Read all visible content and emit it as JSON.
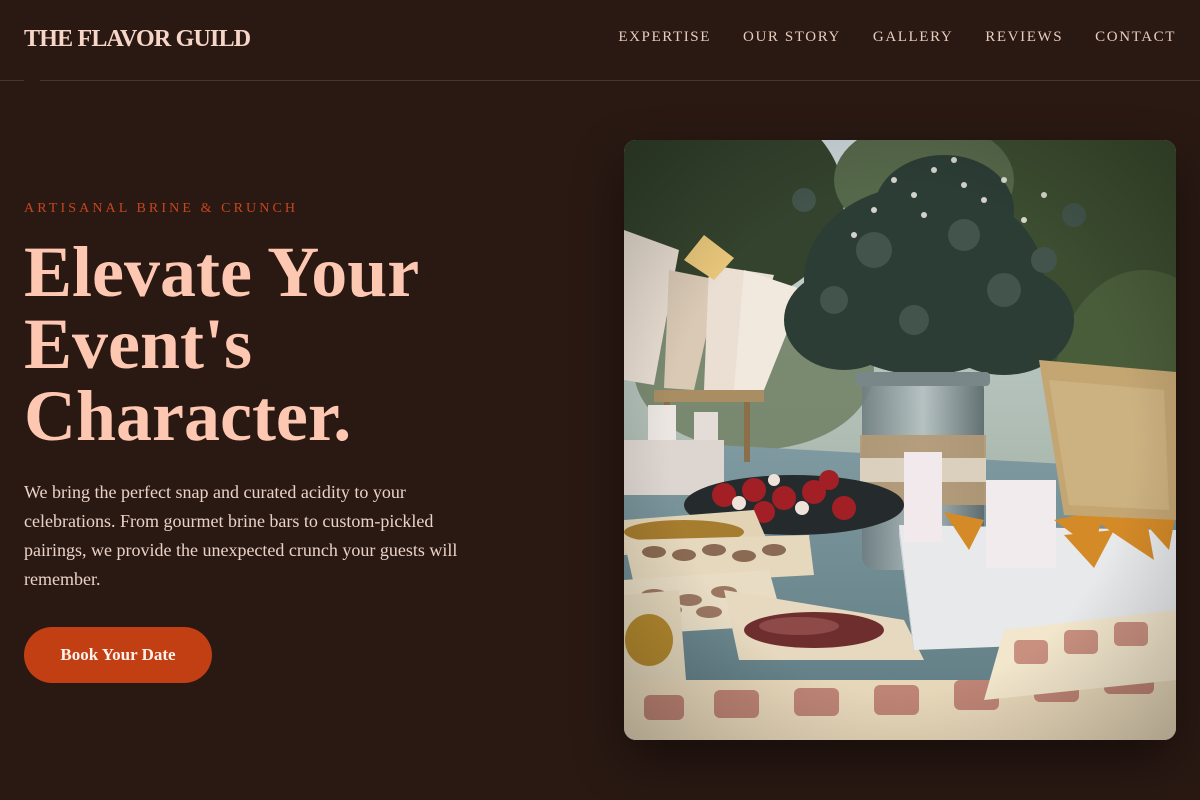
{
  "brand": {
    "name": "THE FLAVOR GUILD"
  },
  "nav": {
    "items": [
      {
        "label": "EXPERTISE"
      },
      {
        "label": "OUR STORY"
      },
      {
        "label": "GALLERY"
      },
      {
        "label": "REVIEWS"
      },
      {
        "label": "CONTACT"
      }
    ]
  },
  "hero": {
    "eyebrow": "ARTISANAL BRINE & CRUNCH",
    "headline": "Elevate Your Event's Character.",
    "description": "We bring the perfect snap and curated acidity to your celebrations. From gourmet brine bars to custom-pickled pairings, we provide the unexpected crunch your guests will remember.",
    "cta_label": "Book Your Date"
  },
  "colors": {
    "background": "#2a1913",
    "accent": "#c23e13",
    "headline": "#fdc7b2",
    "brand": "#f7d6c8",
    "text": "#ead2c6"
  }
}
